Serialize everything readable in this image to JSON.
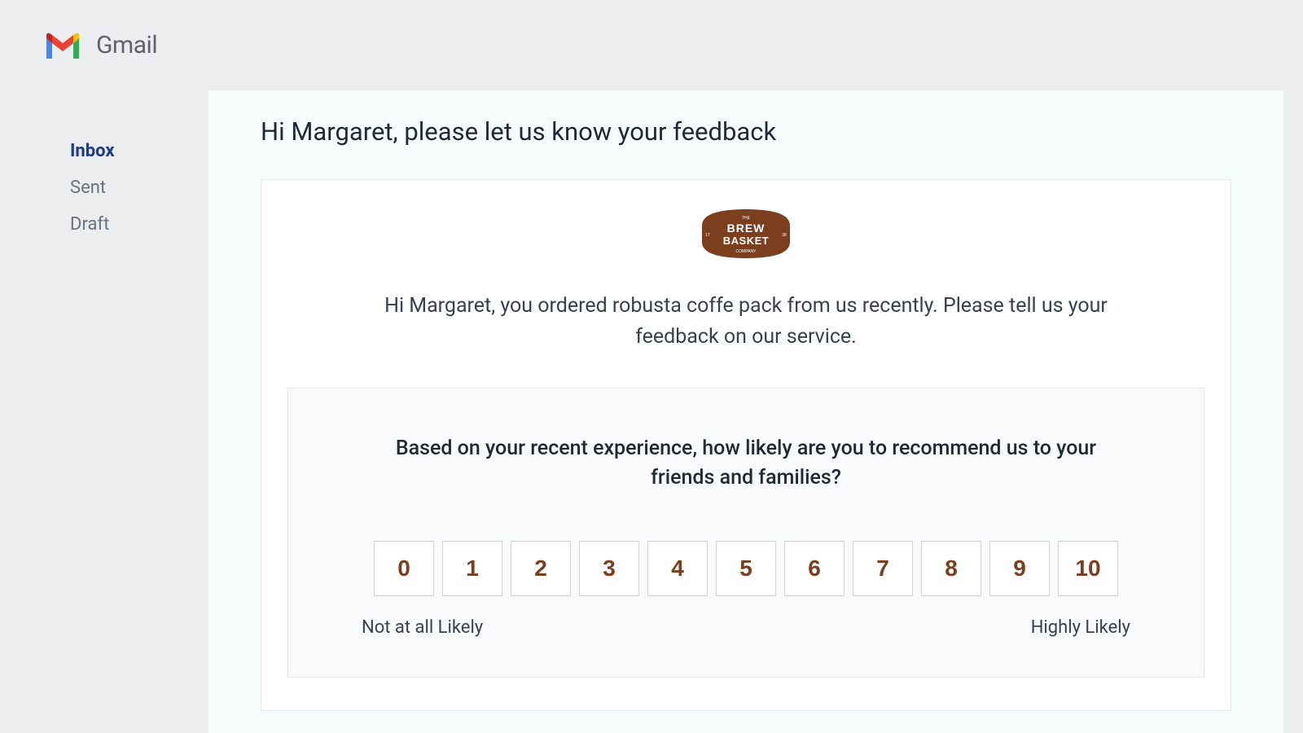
{
  "header": {
    "app_name": "Gmail"
  },
  "sidebar": {
    "items": [
      {
        "label": "Inbox",
        "active": true
      },
      {
        "label": "Sent",
        "active": false
      },
      {
        "label": "Draft",
        "active": false
      }
    ]
  },
  "email": {
    "subject": "Hi Margaret, please let us know your feedback",
    "brand": {
      "top": "THE",
      "line1": "BREW",
      "line2": "BASKET",
      "bottom": "COMPANY",
      "left_num": "17",
      "right_num": "38"
    },
    "intro": "Hi Margaret, you ordered robusta coffe pack from us recently. Please tell us your feedback on our service.",
    "survey": {
      "question": "Based on your recent experience, how likely are you to recommend us to your friends and families?",
      "options": [
        "0",
        "1",
        "2",
        "3",
        "4",
        "5",
        "6",
        "7",
        "8",
        "9",
        "10"
      ],
      "low_label": "Not at all Likely",
      "high_label": "Highly Likely"
    }
  },
  "colors": {
    "brand_brown": "#7b3f1d"
  }
}
